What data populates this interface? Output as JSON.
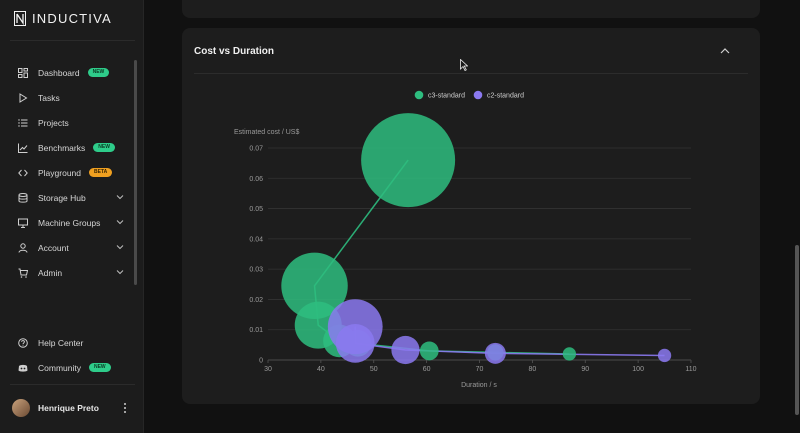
{
  "brand": {
    "name": "INDUCTIVA"
  },
  "nav": [
    {
      "label": "Dashboard",
      "icon": "dashboard-icon",
      "badge": "NEW",
      "badge_type": "new",
      "chevron": false
    },
    {
      "label": "Tasks",
      "icon": "play-icon",
      "badge": null,
      "chevron": false
    },
    {
      "label": "Projects",
      "icon": "list-icon",
      "badge": null,
      "chevron": false
    },
    {
      "label": "Benchmarks",
      "icon": "chart-line-icon",
      "badge": "NEW",
      "badge_type": "new",
      "chevron": false
    },
    {
      "label": "Playground",
      "icon": "code-icon",
      "badge": "BETA",
      "badge_type": "beta",
      "chevron": false
    },
    {
      "label": "Storage Hub",
      "icon": "database-icon",
      "badge": null,
      "chevron": true
    },
    {
      "label": "Machine Groups",
      "icon": "monitor-icon",
      "badge": null,
      "chevron": true
    },
    {
      "label": "Account",
      "icon": "user-icon",
      "badge": null,
      "chevron": true
    },
    {
      "label": "Admin",
      "icon": "cart-icon",
      "badge": null,
      "chevron": true
    }
  ],
  "bottom_nav": [
    {
      "label": "Help Center",
      "icon": "help-icon",
      "badge": null
    },
    {
      "label": "Community",
      "icon": "discord-icon",
      "badge": "NEW",
      "badge_type": "new"
    }
  ],
  "user": {
    "name": "Henrique Preto"
  },
  "panel": {
    "title": "Cost vs Duration"
  },
  "colors": {
    "c3": "#2ebd7f",
    "c2": "#8b79f0",
    "grid": "#333333",
    "axis_text": "#9a9a9a"
  },
  "chart_data": {
    "type": "scatter",
    "xlabel": "Duration / s",
    "ylabel": "Estimated cost / US$",
    "xlim": [
      30,
      110
    ],
    "ylim": [
      0,
      0.07
    ],
    "x_ticks": [
      30,
      40,
      50,
      60,
      70,
      80,
      90,
      100,
      110
    ],
    "y_ticks": [
      0,
      0.01,
      0.02,
      0.03,
      0.04,
      0.05,
      0.06,
      0.07
    ],
    "legend": "top-center",
    "grid": true,
    "series": [
      {
        "name": "c3-standard",
        "color": "#2ebd7f",
        "points": [
          {
            "x": 56.5,
            "y": 0.066,
            "size": 1.0
          },
          {
            "x": 38.8,
            "y": 0.0245,
            "size": 0.5
          },
          {
            "x": 39.5,
            "y": 0.0115,
            "size": 0.25
          },
          {
            "x": 43.5,
            "y": 0.0063,
            "size": 0.12
          },
          {
            "x": 47.0,
            "y": 0.0055,
            "size": 0.08
          },
          {
            "x": 60.5,
            "y": 0.003,
            "size": 0.04
          },
          {
            "x": 73.0,
            "y": 0.0025,
            "size": 0.03
          },
          {
            "x": 87.0,
            "y": 0.002,
            "size": 0.02
          }
        ]
      },
      {
        "name": "c2-standard",
        "color": "#8b79f0",
        "points": [
          {
            "x": 46.5,
            "y": 0.011,
            "size": 0.34
          },
          {
            "x": 46.5,
            "y": 0.0055,
            "size": 0.17
          },
          {
            "x": 56.0,
            "y": 0.0033,
            "size": 0.09
          },
          {
            "x": 73.0,
            "y": 0.0022,
            "size": 0.05
          },
          {
            "x": 105.0,
            "y": 0.0015,
            "size": 0.02
          }
        ]
      }
    ]
  }
}
